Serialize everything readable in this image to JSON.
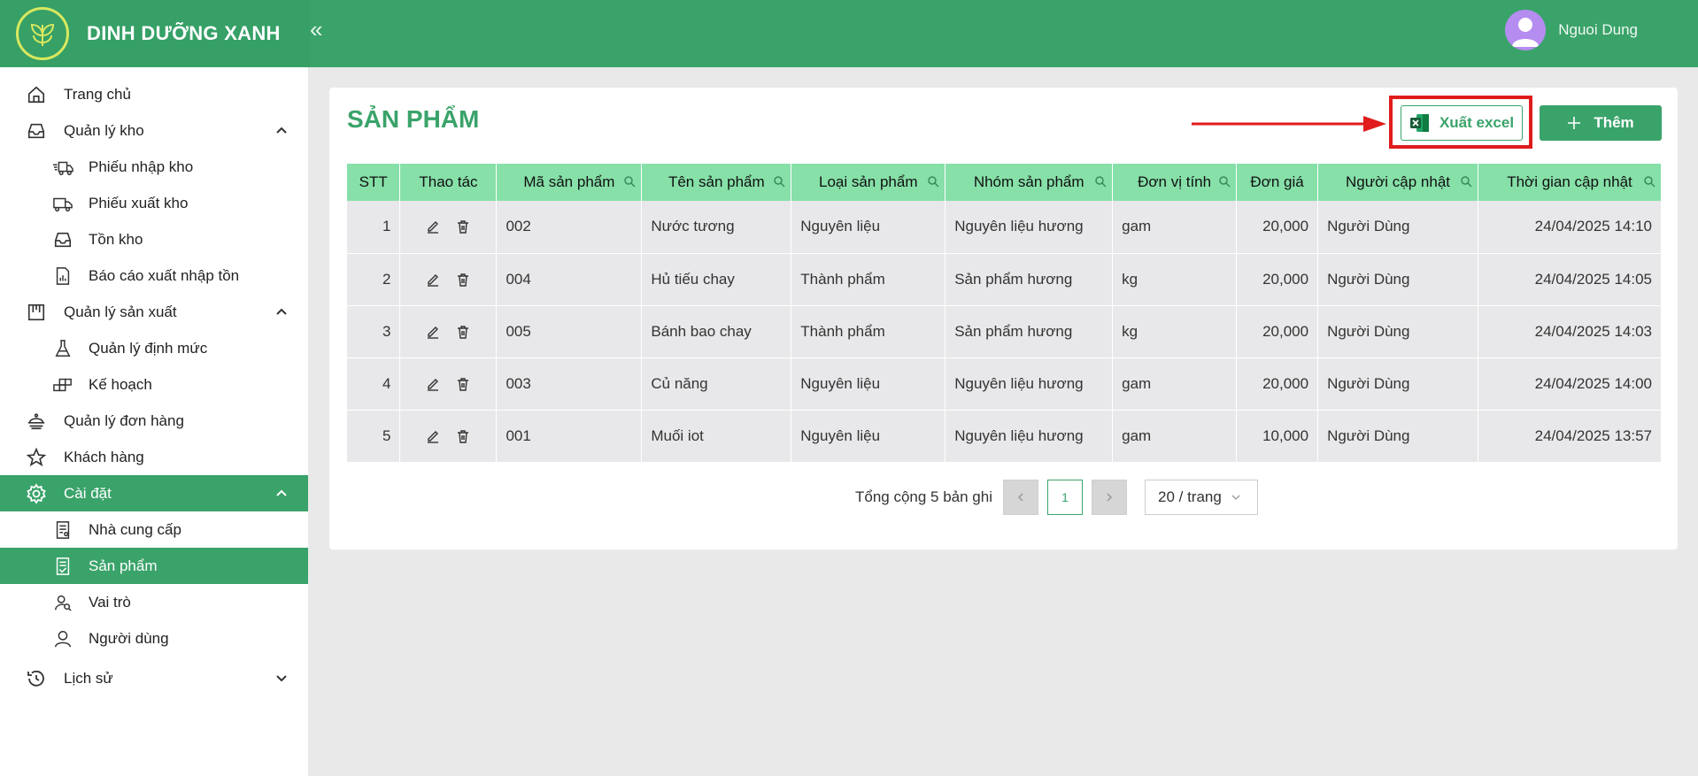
{
  "brand": {
    "name": "DINH DƯỠNG XANH"
  },
  "header": {
    "collapse_glyph": "«",
    "user_name": "Nguoi Dung"
  },
  "sidebar": {
    "items": [
      {
        "label": "Trang chủ",
        "icon": "home-icon",
        "level": "top"
      },
      {
        "label": "Quản lý kho",
        "icon": "inbox-icon",
        "level": "top",
        "chevron": "up"
      },
      {
        "label": "Phiếu nhập kho",
        "icon": "truck-in-icon",
        "level": "sub"
      },
      {
        "label": "Phiếu xuất kho",
        "icon": "truck-out-icon",
        "level": "sub"
      },
      {
        "label": "Tồn kho",
        "icon": "inbox-icon",
        "level": "sub"
      },
      {
        "label": "Báo cáo xuất nhập tồn",
        "icon": "report-icon",
        "level": "sub"
      },
      {
        "label": "Quản lý sản xuất",
        "icon": "factory-icon",
        "level": "top",
        "chevron": "up"
      },
      {
        "label": "Quản lý định mức",
        "icon": "flask-icon",
        "level": "sub"
      },
      {
        "label": "Kế hoạch",
        "icon": "blocks-icon",
        "level": "sub"
      },
      {
        "label": "Quản lý đơn hàng",
        "icon": "order-icon",
        "level": "top"
      },
      {
        "label": "Khách hàng",
        "icon": "star-icon",
        "level": "top"
      },
      {
        "label": "Cài đặt",
        "icon": "gear-icon",
        "level": "top",
        "chevron": "up",
        "active": true
      },
      {
        "label": "Nhà cung cấp",
        "icon": "supplier-icon",
        "level": "sub"
      },
      {
        "label": "Sản phẩm",
        "icon": "product-icon",
        "level": "sub",
        "active": true
      },
      {
        "label": "Vai trò",
        "icon": "role-icon",
        "level": "sub"
      },
      {
        "label": "Người dùng",
        "icon": "user-icon",
        "level": "sub"
      },
      {
        "label": "Lịch sử",
        "icon": "history-icon",
        "level": "top",
        "chevron": "down"
      }
    ]
  },
  "main": {
    "title": "SẢN PHẨM",
    "export_label": "Xuất excel",
    "add_label": "Thêm",
    "table": {
      "headers": [
        "STT",
        "Thao tác",
        "Mã sản phẩm",
        "Tên sản phẩm",
        "Loại sản phẩm",
        "Nhóm sản phẩm",
        "Đơn vị tính",
        "Đơn giá",
        "Người cập nhật",
        "Thời gian cập nhật"
      ],
      "rows": [
        [
          "1",
          "002",
          "Nước tương",
          "Nguyên liệu",
          "Nguyên liệu hương",
          "gam",
          "20,000",
          "Người Dùng",
          "24/04/2025 14:10"
        ],
        [
          "2",
          "004",
          "Hủ tiếu chay",
          "Thành phẩm",
          "Sản phẩm hương",
          "kg",
          "20,000",
          "Người Dùng",
          "24/04/2025 14:05"
        ],
        [
          "3",
          "005",
          "Bánh bao chay",
          "Thành phẩm",
          "Sản phẩm hương",
          "kg",
          "20,000",
          "Người Dùng",
          "24/04/2025 14:03"
        ],
        [
          "4",
          "003",
          "Củ năng",
          "Nguyên liệu",
          "Nguyên liệu hương",
          "gam",
          "20,000",
          "Người Dùng",
          "24/04/2025 14:00"
        ],
        [
          "5",
          "001",
          "Muối iot",
          "Nguyên liệu",
          "Nguyên liệu hương",
          "gam",
          "10,000",
          "Người Dùng",
          "24/04/2025 13:57"
        ]
      ]
    },
    "pagination": {
      "total_text": "Tổng cộng 5 bản ghi",
      "current_page": "1",
      "page_size": "20 / trang"
    }
  },
  "colors": {
    "primary": "#3aa36a",
    "header_row": "#86e0a8",
    "highlight": "#e01c1c"
  }
}
